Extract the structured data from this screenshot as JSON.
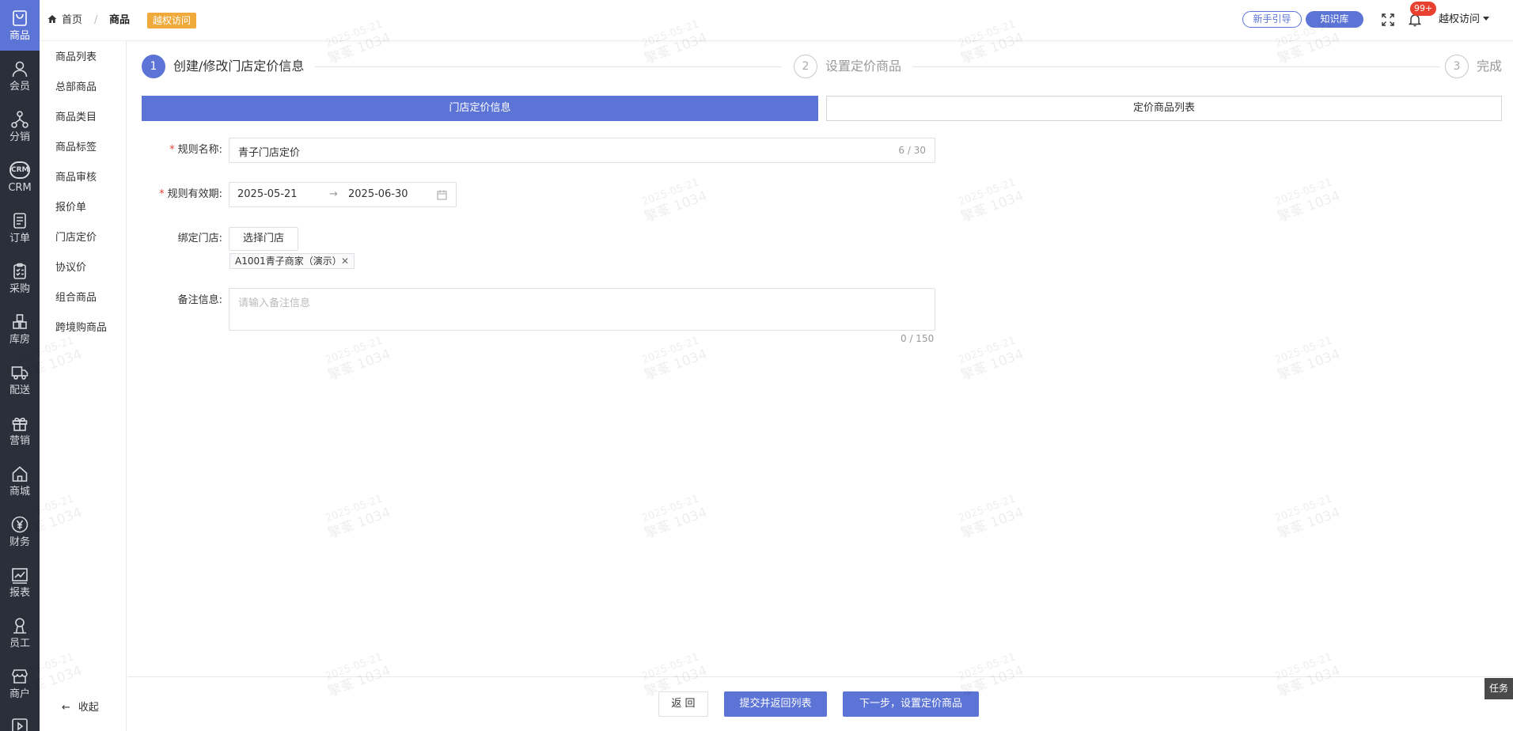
{
  "rail": {
    "items": [
      {
        "label": "商品",
        "icon": "shopping-bag-icon",
        "active": true
      },
      {
        "label": "会员",
        "icon": "user-icon"
      },
      {
        "label": "分销",
        "icon": "network-icon"
      },
      {
        "label": "CRM",
        "icon": "crm-icon",
        "badge": "CRM"
      },
      {
        "label": "订单",
        "icon": "document-icon"
      },
      {
        "label": "采购",
        "icon": "clipboard-icon"
      },
      {
        "label": "库房",
        "icon": "grid-icon"
      },
      {
        "label": "配送",
        "icon": "truck-icon"
      },
      {
        "label": "营销",
        "icon": "gift-icon"
      },
      {
        "label": "商城",
        "icon": "house-icon"
      },
      {
        "label": "财务",
        "icon": "yen-icon"
      },
      {
        "label": "报表",
        "icon": "chart-icon"
      },
      {
        "label": "员工",
        "icon": "staff-icon"
      },
      {
        "label": "商户",
        "icon": "store-icon"
      }
    ]
  },
  "submenu": {
    "items": [
      "商品列表",
      "总部商品",
      "商品类目",
      "商品标签",
      "商品审核",
      "报价单",
      "门店定价",
      "协议价",
      "组合商品",
      "跨境购商品"
    ],
    "collapse": "收起"
  },
  "header": {
    "home": "首页",
    "separator": "/",
    "current": "商品",
    "badge": "越权访问",
    "guide": "新手引导",
    "knowledge": "知识库",
    "notif_count": "99+",
    "user": "越权访问"
  },
  "watermark": {
    "date": "2025-05-21",
    "name": "擎莑 1034"
  },
  "steps": [
    {
      "num": "1",
      "label": "创建/修改门店定价信息"
    },
    {
      "num": "2",
      "label": "设置定价商品"
    },
    {
      "num": "3",
      "label": "完成"
    }
  ],
  "tabs": {
    "info": "门店定价信息",
    "list": "定价商品列表"
  },
  "form": {
    "rule_name_label": "规则名称:",
    "rule_name_value": "青子门店定价",
    "rule_name_count": "6 / 30",
    "validity_label": "规则有效期:",
    "date_start": "2025-05-21",
    "date_arrow": "→",
    "date_end": "2025-06-30",
    "store_label": "绑定门店:",
    "store_button": "选择门店",
    "store_tag": "A1001青子商家（演示）",
    "remark_label": "备注信息:",
    "remark_placeholder": "请输入备注信息",
    "remark_count": "0 / 150"
  },
  "footer": {
    "back": "返 回",
    "submit": "提交并返回列表",
    "next": "下一步，设置定价商品"
  },
  "task": "任务",
  "colors": {
    "primary": "#5b74d6",
    "rail": "#2b2f3a",
    "badge": "#f0a93b",
    "alert": "#e8412f"
  }
}
